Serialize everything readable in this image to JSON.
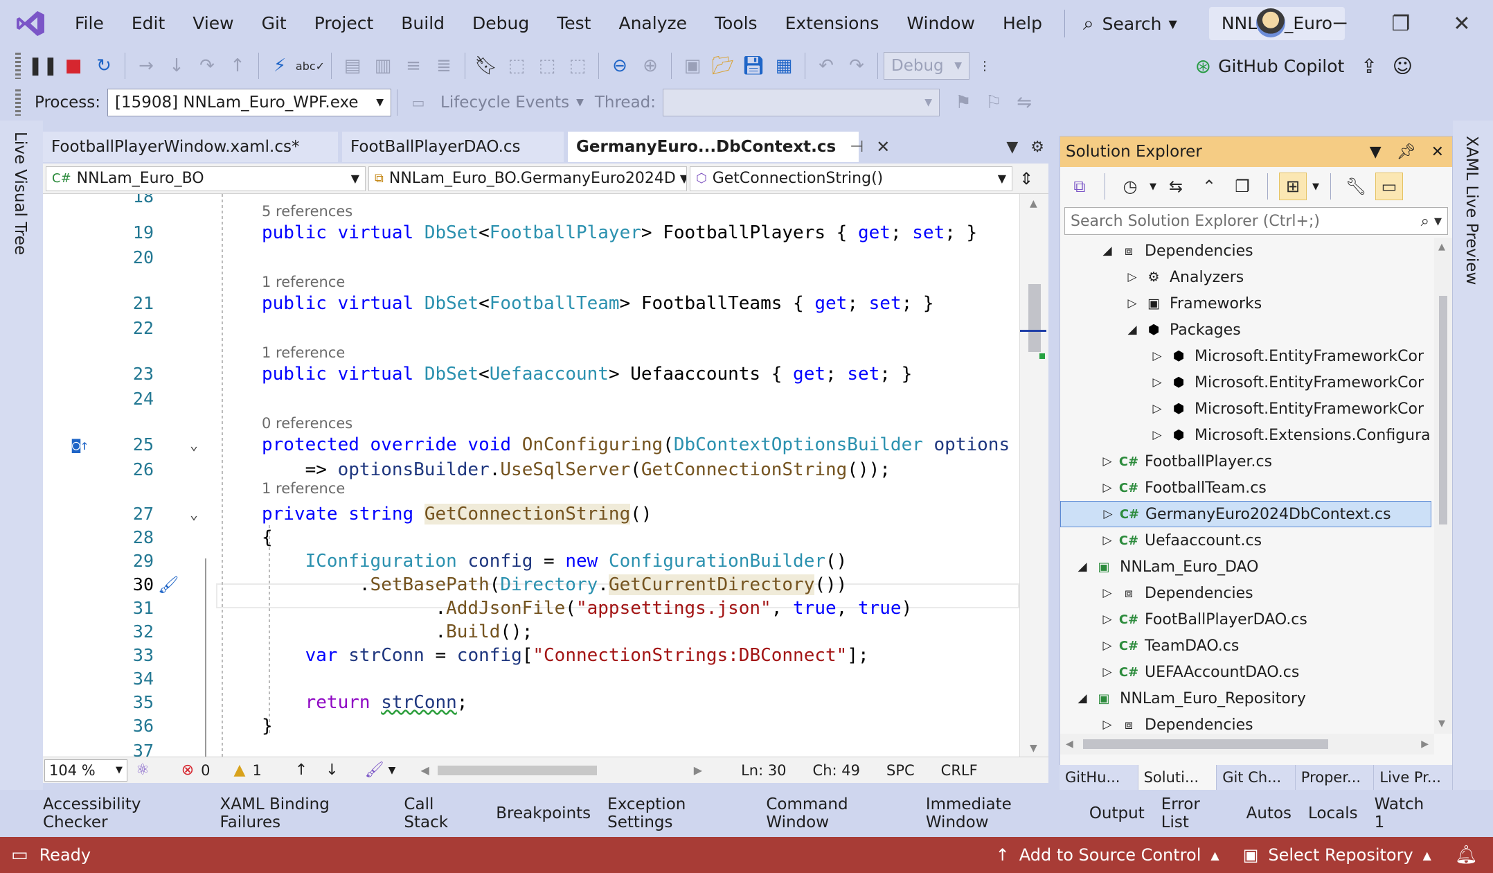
{
  "menu": [
    "File",
    "Edit",
    "View",
    "Git",
    "Project",
    "Build",
    "Debug",
    "Test",
    "Analyze",
    "Tools",
    "Extensions",
    "Window",
    "Help"
  ],
  "search_label": "Search",
  "project_badge": "NNLam_Euro",
  "copilot_label": "GitHub Copilot",
  "toolbar": {
    "config_value": "Debug",
    "process_label": "Process:",
    "process_value": "[15908] NNLam_Euro_WPF.exe",
    "lifecycle_label": "Lifecycle Events",
    "thread_label": "Thread:"
  },
  "side_labels": {
    "left": "Live Visual Tree",
    "right": "XAML Live Preview"
  },
  "editor": {
    "tabs": [
      "FootballPlayerWindow.xaml.cs*",
      "FootBallPlayerDAO.cs",
      "GermanyEuro...DbContext.cs"
    ],
    "nav_project": "NNLam_Euro_BO",
    "nav_class": "NNLam_Euro_BO.GermanyEuro2024D",
    "nav_member": "GetConnectionString()",
    "line_numbers": [
      "18",
      "19",
      "20",
      "21",
      "22",
      "23",
      "24",
      "25",
      "26",
      "27",
      "28",
      "29",
      "30",
      "31",
      "32",
      "33",
      "34",
      "35",
      "36",
      "37"
    ],
    "lens": {
      "l19": "5 references",
      "l21": "1 reference",
      "l23": "1 reference",
      "l25": "0 references",
      "l27": "1 reference"
    }
  },
  "editor_status": {
    "zoom": "104 %",
    "errors": "0",
    "warnings": "1",
    "ln": "Ln: 30",
    "ch": "Ch: 49",
    "spc": "SPC",
    "crlf": "CRLF"
  },
  "solution_explorer": {
    "title": "Solution Explorer",
    "search_placeholder": "Search Solution Explorer (Ctrl+;)",
    "tree": [
      {
        "label": "Dependencies",
        "icon": "dependencies-icon"
      },
      {
        "label": "Analyzers",
        "icon": "analyzers-icon"
      },
      {
        "label": "Frameworks",
        "icon": "frameworks-icon"
      },
      {
        "label": "Packages",
        "icon": "package-icon"
      },
      {
        "label": "Microsoft.EntityFrameworkCor",
        "icon": "package-icon"
      },
      {
        "label": "Microsoft.EntityFrameworkCor",
        "icon": "package-icon"
      },
      {
        "label": "Microsoft.EntityFrameworkCor",
        "icon": "package-icon"
      },
      {
        "label": "Microsoft.Extensions.Configura",
        "icon": "package-icon"
      },
      {
        "label": "FootballPlayer.cs",
        "icon": "csharp-file-icon"
      },
      {
        "label": "FootballTeam.cs",
        "icon": "csharp-file-icon"
      },
      {
        "label": "GermanyEuro2024DbContext.cs",
        "icon": "csharp-file-icon"
      },
      {
        "label": "Uefaaccount.cs",
        "icon": "csharp-file-icon"
      },
      {
        "label": "NNLam_Euro_DAO",
        "icon": "csharp-project-icon"
      },
      {
        "label": "Dependencies",
        "icon": "dependencies-icon"
      },
      {
        "label": "FootBallPlayerDAO.cs",
        "icon": "csharp-file-icon"
      },
      {
        "label": "TeamDAO.cs",
        "icon": "csharp-file-icon"
      },
      {
        "label": "UEFAAccountDAO.cs",
        "icon": "csharp-file-icon"
      },
      {
        "label": "NNLam_Euro_Repository",
        "icon": "csharp-project-icon"
      },
      {
        "label": "Dependencies",
        "icon": "dependencies-icon"
      }
    ],
    "bottom_tabs": [
      "GitHu...",
      "Soluti...",
      "Git Ch...",
      "Proper...",
      "Live Pr..."
    ]
  },
  "tool_tabs": [
    "Accessibility Checker",
    "XAML Binding Failures",
    "Call Stack",
    "Breakpoints",
    "Exception Settings",
    "Command Window",
    "Immediate Window",
    "Output",
    "Error List",
    "Autos",
    "Locals",
    "Watch 1"
  ],
  "status_bar": {
    "ready": "Ready",
    "source_control": "Add to Source Control",
    "repository": "Select Repository"
  },
  "colors": {
    "status_bar": "#a83c36",
    "solution_header": "#f5cc84",
    "chrome": "#cfd6ee",
    "keyword": "#0000ff",
    "type": "#2b91af",
    "string": "#a31515"
  }
}
